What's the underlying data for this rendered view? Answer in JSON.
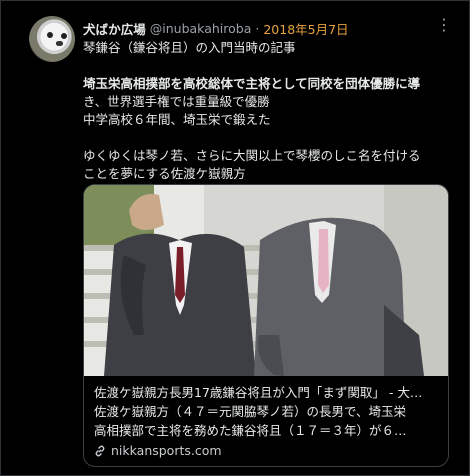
{
  "tweet": {
    "author_name": "犬ばか広場",
    "handle": "@inubakahiroba",
    "separator": "·",
    "date": "2018年5月7日",
    "more_label": "⋮",
    "lines": [
      "琴鎌谷（鎌谷将且）の入門当時の記事",
      "",
      "埼玉栄高相撲部を高校総体で主将として同校を団体優勝に導",
      "き、世界選手権では重量級で優勝",
      "中学高校６年間、埼玉栄で鍛えた",
      "",
      "ゆくゆくは琴ノ若、さらに大関以上で琴櫻のしこ名を付ける",
      "ことを夢にする佐渡ケ嶽親方"
    ]
  },
  "card": {
    "title": "佐渡ケ嶽親方長男17歳鎌谷将且が入門「まず関取」 - 大…",
    "description_1": "佐渡ケ嶽親方（４７＝元関脇琴ノ若）の長男で、埼玉栄",
    "description_2": "高相撲部で主将を務めた鎌谷将且（１７＝３年）が６…",
    "domain": "nikkansports.com"
  },
  "colors": {
    "background": "#000000",
    "text": "#e7e9ea",
    "muted": "#9aa0a6",
    "date": "#e8a33d",
    "border": "#2f3336"
  },
  "icons": [
    "dog-avatar-icon",
    "more-options-icon",
    "link-icon"
  ]
}
